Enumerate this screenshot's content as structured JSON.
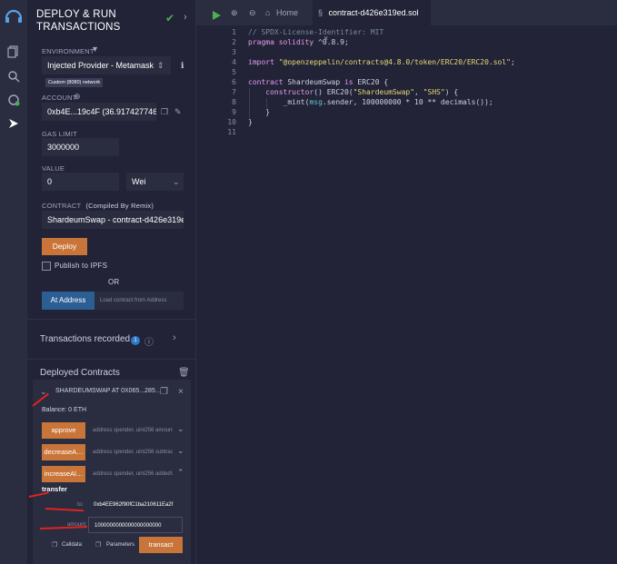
{
  "panel": {
    "title_line1": "DEPLOY & RUN",
    "title_line2": "TRANSACTIONS",
    "environment_label": "ENVIRONMENT",
    "environment_value": "Injected Provider - Metamask",
    "network_badge": "Custom (8080) network",
    "account_label": "ACCOUNT",
    "account_value": "0xb4E...19c4F (36.917427746)",
    "gas_limit_label": "GAS LIMIT",
    "gas_limit_value": "3000000",
    "value_label": "VALUE",
    "value_amount": "0",
    "value_unit": "Wei",
    "contract_label": "CONTRACT",
    "contract_compiled": "(Compiled By Remix)",
    "contract_value": "ShardeumSwap - contract-d426e319ed.sol",
    "deploy_label": "Deploy",
    "publish_label": "Publish to IPFS",
    "or_label": "OR",
    "at_address_label": "At Address",
    "load_placeholder": "Load contract from Address",
    "tx_recorded_label": "Transactions recorded",
    "tx_recorded_count": "1",
    "deployed_label": "Deployed Contracts",
    "instance_name": "SHARDEUMSWAP AT 0X065...285…",
    "balance": "Balance: 0 ETH",
    "functions": [
      {
        "name": "approve",
        "hint": "address spender, uint256 amount"
      },
      {
        "name": "decreaseA…",
        "hint": "address spender, uint256 subtractedValue"
      },
      {
        "name": "increaseAl…",
        "hint": "address spender, uint256 addedValue"
      }
    ],
    "transfer_label": "transfer",
    "to_label": "to:",
    "to_value": "0xb4EE962f90fC1ba210611Ea2f",
    "amount_label": "amount:",
    "amount_value": "1000000000000000000000",
    "calldata_label": "Calldata",
    "parameters_label": "Parameters",
    "transact_label": "transact"
  },
  "editor": {
    "home_tab": "Home",
    "file_tab": "contract-d426e319ed.sol",
    "line_numbers": [
      "1",
      "2",
      "3",
      "4",
      "5",
      "6",
      "7",
      "8",
      "9",
      "10",
      "11"
    ],
    "code": {
      "l1": "// SPDX-License-Identifier: MIT",
      "l2_kw": "pragma solidity",
      "l2_rest": " ^0.8.9;",
      "l4_kw": "import",
      "l4_str": " \"@openzeppelin/contracts@4.8.0/token/ERC20/ERC20.sol\"",
      "l4_end": ";",
      "l6_kw": "contract",
      "l6_rest": " ShardeumSwap ",
      "l6_kw2": "is",
      "l6_end": " ERC20 {",
      "l7_kw": "    constructor",
      "l7_a": "() ERC20(",
      "l7_s1": "\"ShardeumSwap\"",
      "l7_b": ", ",
      "l7_s2": "\"SHS\"",
      "l7_c": ") {",
      "l8_a": "        _mint(",
      "l8_msg": "msg",
      "l8_b": ".sender, 100000000 * 10 ** decimals());",
      "l9": "    }",
      "l10": "}"
    }
  },
  "colors": {
    "accent": "#c97539",
    "background": "#222336",
    "panel": "#2a2c3f",
    "annotation": "#e0241f"
  }
}
